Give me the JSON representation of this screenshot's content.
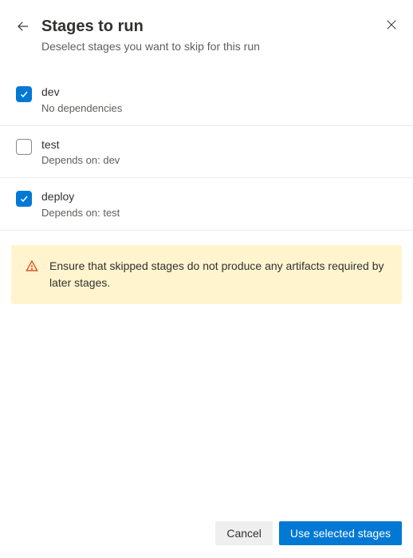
{
  "header": {
    "title": "Stages to run",
    "subtitle": "Deselect stages you want to skip for this run"
  },
  "stages": [
    {
      "name": "dev",
      "dependencies": "No dependencies",
      "checked": true
    },
    {
      "name": "test",
      "dependencies": "Depends on: dev",
      "checked": false
    },
    {
      "name": "deploy",
      "dependencies": "Depends on: test",
      "checked": true
    }
  ],
  "warning": {
    "message": "Ensure that skipped stages do not produce any artifacts required by later stages."
  },
  "footer": {
    "cancel_label": "Cancel",
    "primary_label": "Use selected stages"
  }
}
